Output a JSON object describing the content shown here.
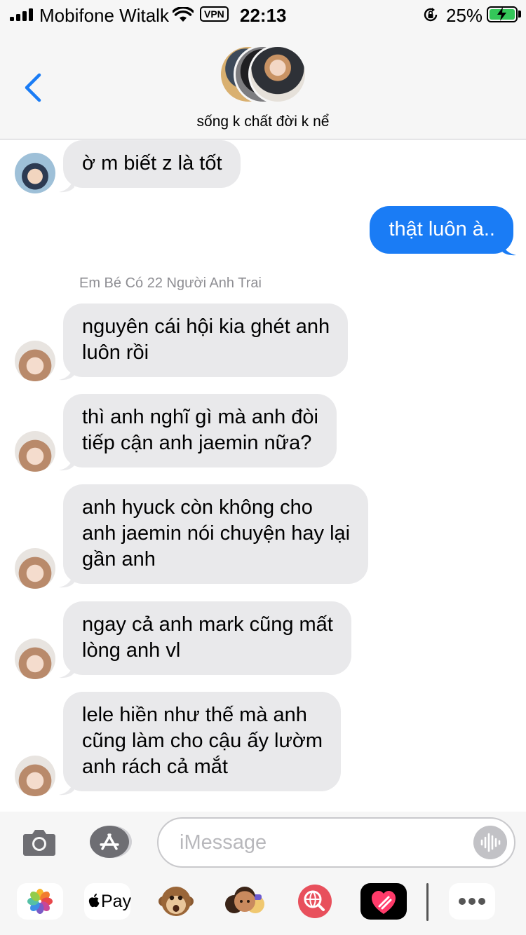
{
  "status_bar": {
    "carrier": "Mobifone Witalk",
    "vpn_label": "VPN",
    "time": "22:13",
    "battery_percent": "25%",
    "battery_level": 0.25,
    "charging_color": "#34c759"
  },
  "header": {
    "title": "sống k chất đời k nể",
    "back_icon": "chevron-left-icon",
    "accent": "#1a7cf5"
  },
  "thread": {
    "messages": [
      {
        "direction": "incoming",
        "text": "ờ m biết z là tốt",
        "avatar": "friend-avatar"
      },
      {
        "direction": "outgoing",
        "text": "thật luôn à.."
      },
      {
        "direction": "incoming",
        "text": "nguyên cái hội kia ghét anh\nluôn rồi",
        "avatar": "sender-avatar"
      },
      {
        "direction": "incoming",
        "text": "thì anh nghĩ gì mà anh đòi\ntiếp cận anh jaemin nữa?",
        "avatar": "sender-avatar"
      },
      {
        "direction": "incoming",
        "text": "anh hyuck còn không cho\nanh jaemin nói chuyện hay lại\ngần anh",
        "avatar": "sender-avatar"
      },
      {
        "direction": "incoming",
        "text": "ngay cả anh mark cũng mất\nlòng anh vl",
        "avatar": "sender-avatar"
      },
      {
        "direction": "incoming",
        "text": "lele hiền như thế mà anh\ncũng làm cho cậu ấy lườm\nanh rách cả mắt",
        "avatar": "sender-avatar"
      }
    ],
    "sender_name": "Em Bé Có 22 Người Anh Trai",
    "incoming_color": "#e9e9eb",
    "outgoing_color": "#1a7cf5"
  },
  "input_bar": {
    "placeholder": "iMessage",
    "camera_icon": "camera-icon",
    "apps_icon": "app-store-icon",
    "audio_icon": "audio-waveform-icon"
  },
  "app_drawer": {
    "apps": [
      "photos-icon",
      "apple-pay-icon",
      "monkey-memoji-icon",
      "memoji-stickers-icon",
      "image-search-icon",
      "digital-touch-icon",
      "more-apps-icon"
    ],
    "pay_label": "Pay"
  }
}
